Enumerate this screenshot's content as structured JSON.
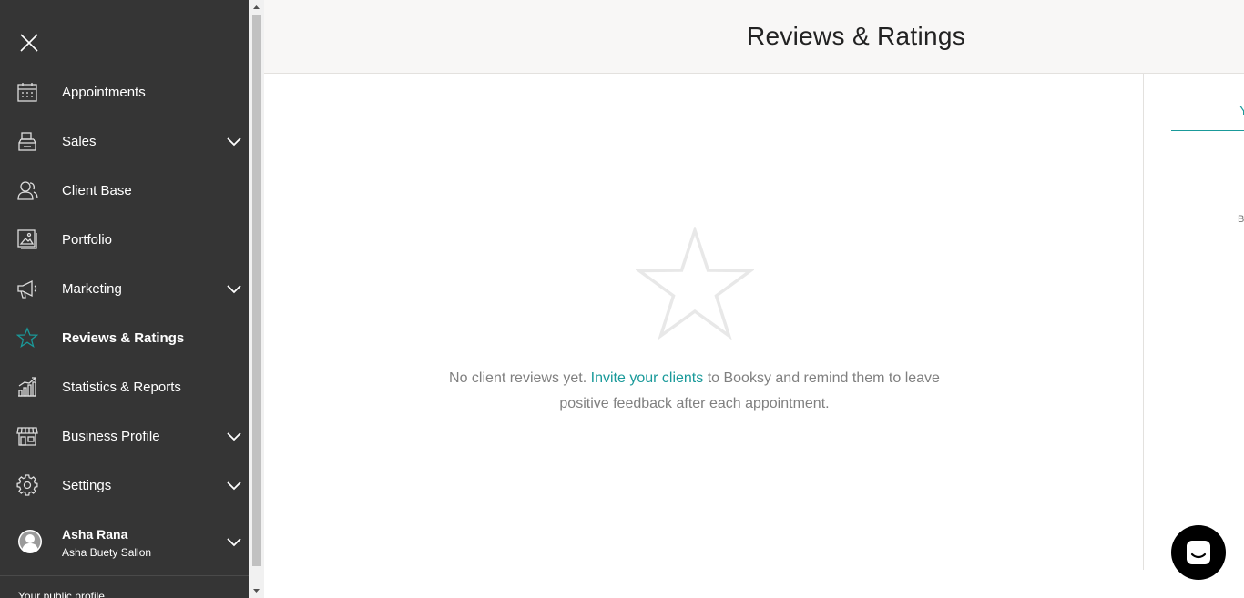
{
  "sidebar": {
    "items": [
      {
        "label": "Appointments",
        "icon": "calendar-icon",
        "has_dropdown": false
      },
      {
        "label": "Sales",
        "icon": "cash-register-icon",
        "has_dropdown": true
      },
      {
        "label": "Client Base",
        "icon": "clients-icon",
        "has_dropdown": false
      },
      {
        "label": "Portfolio",
        "icon": "image-gallery-icon",
        "has_dropdown": false
      },
      {
        "label": "Marketing",
        "icon": "megaphone-icon",
        "has_dropdown": true
      },
      {
        "label": "Reviews & Ratings",
        "icon": "star-icon",
        "has_dropdown": false,
        "active": true
      },
      {
        "label": "Statistics & Reports",
        "icon": "chart-icon",
        "has_dropdown": false
      },
      {
        "label": "Business Profile",
        "icon": "storefront-icon",
        "has_dropdown": true
      },
      {
        "label": "Settings",
        "icon": "gear-icon",
        "has_dropdown": true
      }
    ],
    "user": {
      "name": "Asha Rana",
      "business": "Asha Buety Sallon"
    },
    "public_profile_label": "Your public profile"
  },
  "header": {
    "title": "Reviews & Ratings"
  },
  "main": {
    "empty_prefix": "No client reviews yet. ",
    "empty_link": "Invite your clients",
    "empty_suffix": " to Booksy and remind them to leave positive feedback after each appointment."
  },
  "right_panel": {
    "tab_label": "Y",
    "label": "B"
  },
  "colors": {
    "sidebar_bg": "#353535",
    "accent": "#1a9a9a",
    "header_bg": "#f8f7f6"
  }
}
